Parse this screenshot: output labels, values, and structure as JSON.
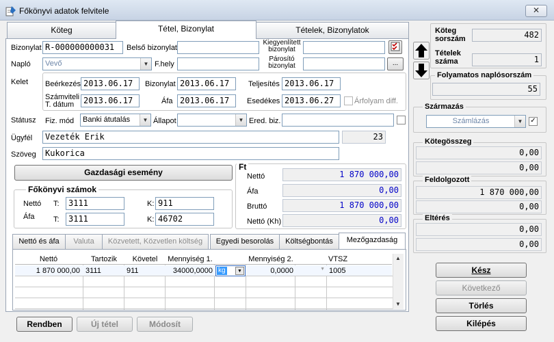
{
  "window": {
    "title": "Főkönyvi adatok felvitele",
    "close": "✕"
  },
  "tabs": [
    "Köteg",
    "Tétel, Bizonylat",
    "Tételek, Bizonylatok"
  ],
  "form": {
    "bizonylat_label": "Bizonylat",
    "bizonylat_value": "R-000000000031",
    "belso_label": "Belső bizonylat",
    "belso_value": "",
    "kiegy_label": "Kiegyenlített bizonylat",
    "kiegy_value": "",
    "naplo_label": "Napló",
    "naplo_value": "Vevő",
    "fhely_label": "F.hely",
    "fhely_value": "",
    "parosito_label": "Párosító bizonylat",
    "parosito_value": "",
    "parosito_btn": "...",
    "kelet_label": "Kelet",
    "beerkezes_label": "Beérkezés",
    "beerkezes_value": "2013.06.17",
    "biz_date_label": "Bizonylat",
    "biz_date_value": "2013.06.17",
    "teljesites_label": "Teljesítés",
    "teljesites_value": "2013.06.17",
    "szamviteli_label": "Számviteli T. dátum",
    "szamviteli_value": "2013.06.17",
    "afa_date_label": "Áfa",
    "afa_date_value": "2013.06.17",
    "esedekes_label": "Esedékes",
    "esedekes_value": "2013.06.27",
    "arfolyam_label": "Árfolyam diff.",
    "status_label": "Státusz",
    "fizmod_label": "Fiz. mód",
    "fizmod_value": "Banki átutalás",
    "allapot_label": "Állapot",
    "allapot_value": "",
    "eredbiz_label": "Ered. biz.",
    "eredbiz_value": "",
    "ugyfel_label": "Ügyfél",
    "ugyfel_value": "Vezeték Erik",
    "ugyfel_code": "23",
    "szoveg_label": "Szöveg",
    "szoveg_value": "Kukorica"
  },
  "gazdasagi_button": "Gazdasági esemény",
  "fokonyvi": {
    "title": "Főkönyvi számok",
    "netto_label": "Nettó",
    "afa_label": "Áfa",
    "t_label": "T:",
    "k_label": "K:",
    "netto_t": "3111",
    "netto_k": "911",
    "afa_t": "3111",
    "afa_k": "46702"
  },
  "ft": {
    "title": "Ft",
    "netto_label": "Nettó",
    "netto_value": "1 870 000,00",
    "afa_label": "Áfa",
    "afa_value": "0,00",
    "brutto_label": "Bruttó",
    "brutto_value": "1 870 000,00",
    "nettokh_label": "Nettó (Kh)",
    "nettokh_value": "0,00"
  },
  "subtabs": [
    "Nettó és áfa",
    "Valuta",
    "Közvetett, Közvetlen költség",
    "Egyedi besorolás",
    "Költségbontás",
    "Mezőgazdaság"
  ],
  "grid": {
    "headers": [
      "Nettó",
      "Tartozik",
      "Követel",
      "Mennyiség 1.",
      "",
      "Mennyiség 2.",
      "",
      "VTSZ"
    ],
    "row": [
      "1 870 000,00",
      "3111",
      "911",
      "34000,0000",
      "kg",
      "0,0000",
      "",
      "1005"
    ]
  },
  "bottom_buttons": [
    "Rendben",
    "Új tétel",
    "Módosít"
  ],
  "right": {
    "koteg_sorszam_label": "Köteg sorszám",
    "koteg_sorszam_value": "482",
    "tetelek_szama_label": "Tételek száma",
    "tetelek_szama_value": "1",
    "folyamatos_label": "Folyamatos naplósorszám",
    "folyamatos_value": "55",
    "szarmazas_label": "Származás",
    "szarmazas_value": "Számlázás",
    "kotegosszeg_label": "Kötegösszeg",
    "kotegosszeg_1": "0,00",
    "kotegosszeg_2": "0,00",
    "feldolgozott_label": "Feldolgozott",
    "feldolgozott_1": "1 870 000,00",
    "feldolgozott_2": "0,00",
    "elteres_label": "Eltérés",
    "elteres_1": "0,00",
    "elteres_2": "0,00"
  },
  "right_buttons": [
    "Kész",
    "Következő",
    "Törlés",
    "Kilépés"
  ],
  "colors": {
    "value_blue": "#0000c8",
    "accent": "#1d5fb0"
  }
}
